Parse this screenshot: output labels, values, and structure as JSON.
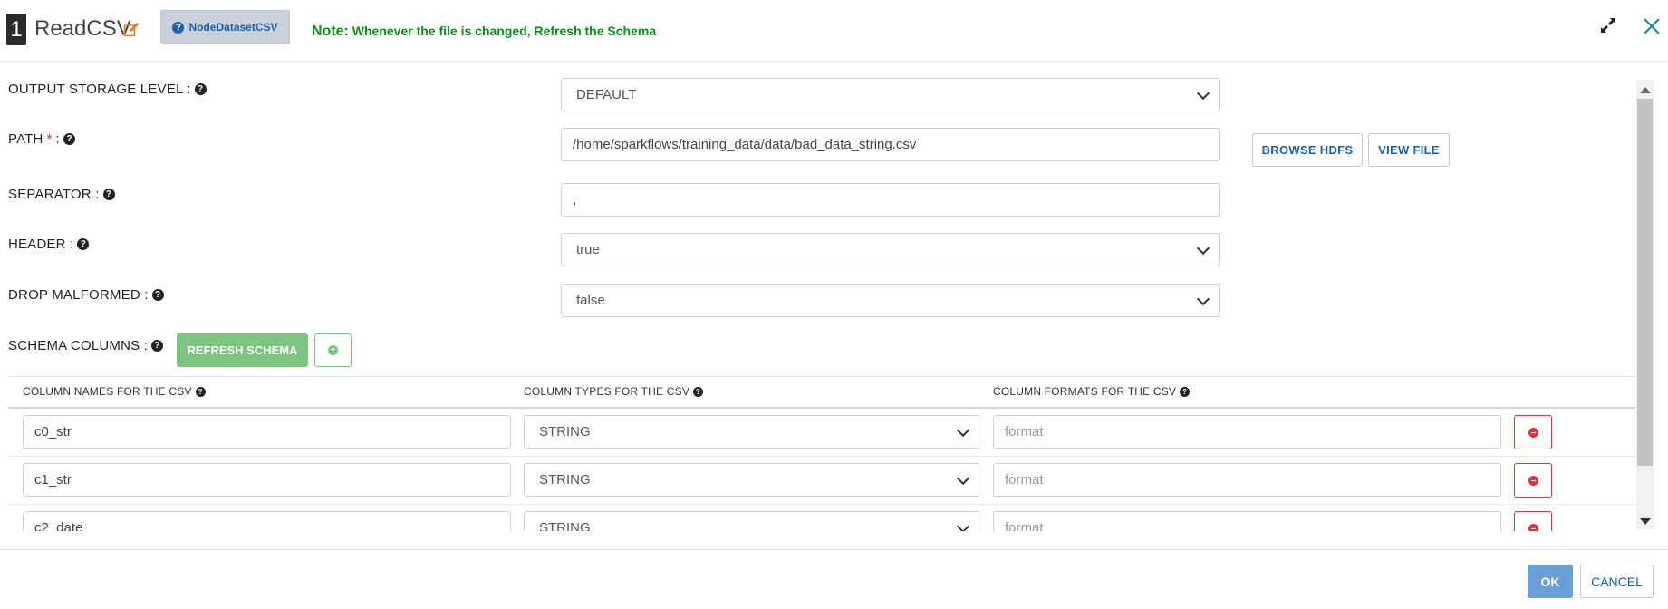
{
  "header": {
    "step_number": "1",
    "title": "ReadCSV",
    "node_type_label": "NodeDatasetCSV",
    "note_label": "Note:",
    "note_text": "Whenever the file is changed, Refresh the Schema"
  },
  "form": {
    "output_storage_level": {
      "label": "OUTPUT STORAGE LEVEL :",
      "value": "DEFAULT"
    },
    "path": {
      "label": "PATH",
      "required_mark": "*",
      "suffix": ":",
      "value": "/home/sparkflows/training_data/data/bad_data_string.csv"
    },
    "separator": {
      "label": "SEPARATOR :",
      "value": ","
    },
    "header": {
      "label": "HEADER :",
      "value": "true"
    },
    "drop_malformed": {
      "label": "DROP MALFORMED :",
      "value": "false"
    },
    "schema_columns": {
      "label": "SCHEMA COLUMNS :"
    }
  },
  "buttons": {
    "browse_hdfs": "BROWSE HDFS",
    "view_file": "VIEW FILE",
    "refresh_schema": "REFRESH SCHEMA",
    "ok": "OK",
    "cancel": "CANCEL"
  },
  "schema_table": {
    "headers": {
      "names": "COLUMN NAMES FOR THE CSV",
      "types": "COLUMN TYPES FOR THE CSV",
      "formats": "COLUMN FORMATS FOR THE CSV"
    },
    "format_placeholder": "format",
    "rows": [
      {
        "name": "c0_str",
        "type": "STRING",
        "format": ""
      },
      {
        "name": "c1_str",
        "type": "STRING",
        "format": ""
      },
      {
        "name": "c2_date",
        "type": "STRING",
        "format": ""
      }
    ]
  },
  "colors": {
    "note_green": "#0d8a1a",
    "refresh_green": "#7cc47f",
    "ok_blue": "#6a9fd6",
    "delete_red": "#d9363e",
    "link_blue": "#1f5ea8"
  },
  "icons": {
    "edit": "edit-icon",
    "help": "question-circle-icon",
    "expand": "expand-icon",
    "close": "close-icon",
    "add": "plus-circle-icon",
    "delete": "minus-circle-icon"
  }
}
